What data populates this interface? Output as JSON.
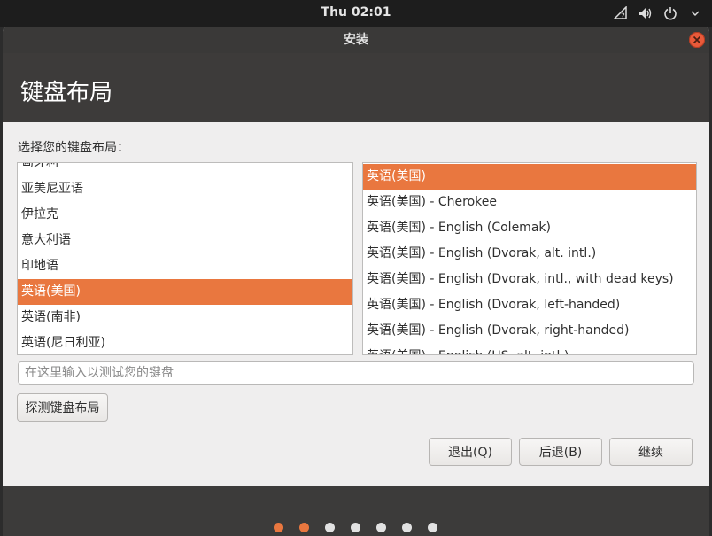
{
  "topbar": {
    "clock": "Thu 02:01",
    "icons": [
      "network-icon",
      "volume-icon",
      "power-icon",
      "chevron-down-icon"
    ]
  },
  "window": {
    "title": "安装",
    "header_title": "键盘布局",
    "prompt": "选择您的键盘布局："
  },
  "layouts": {
    "items": [
      "匈牙利",
      "亚美尼亚语",
      "伊拉克",
      "意大利语",
      "印地语",
      "英语(美国)",
      "英语(南非)",
      "英语(尼日利亚)"
    ],
    "selected_index": 5
  },
  "variants": {
    "items": [
      "英语(美国)",
      "英语(美国) - Cherokee",
      "英语(美国) - English (Colemak)",
      "英语(美国) - English (Dvorak, alt. intl.)",
      "英语(美国) - English (Dvorak, intl., with dead keys)",
      "英语(美国) - English (Dvorak, left-handed)",
      "英语(美国) - English (Dvorak, right-handed)",
      "英语(美国) - English (US, alt. intl.)"
    ],
    "selected_index": 0
  },
  "test_input": {
    "placeholder": "在这里输入以测试您的键盘",
    "value": ""
  },
  "buttons": {
    "detect": "探测键盘布局",
    "quit": "退出(Q)",
    "back": "后退(B)",
    "continue": "继续"
  },
  "progress": {
    "total_steps": 7,
    "completed_steps": 2
  },
  "colors": {
    "accent": "#e9773f",
    "header_bg": "#3d3b3a",
    "close": "#e95a3a"
  }
}
